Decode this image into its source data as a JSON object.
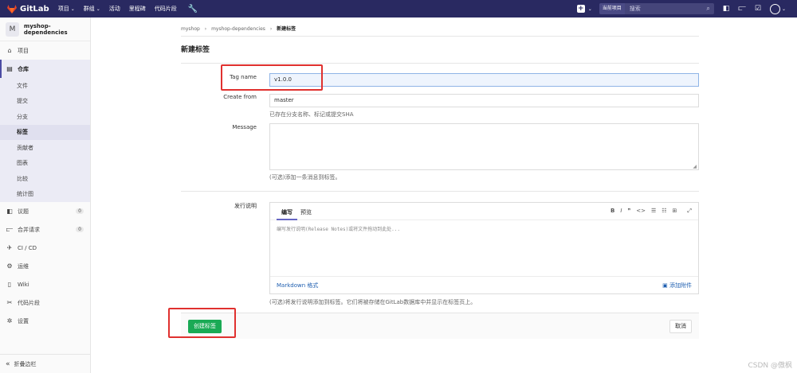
{
  "topbar": {
    "brand": "GitLab",
    "nav": [
      {
        "label": "项目",
        "caret": "⌄"
      },
      {
        "label": "群组",
        "caret": "⌄"
      },
      {
        "label": "活动",
        "caret": ""
      },
      {
        "label": "里程碑",
        "caret": ""
      },
      {
        "label": "代码片段",
        "caret": ""
      }
    ],
    "scope_chip": "当前项目",
    "search_placeholder": "搜索"
  },
  "sidebar": {
    "project_initial": "M",
    "project_name": "myshop-dependencies",
    "items": [
      {
        "label": "项目",
        "icon": "home-icon"
      },
      {
        "label": "仓库",
        "icon": "repo-icon"
      }
    ],
    "repo_sub": [
      "文件",
      "提交",
      "分支",
      "标签",
      "贡献者",
      "图表",
      "比较",
      "统计图"
    ],
    "current_sub": "标签",
    "items2": [
      {
        "label": "议题",
        "icon": "issues-icon",
        "badge": "0"
      },
      {
        "label": "合并请求",
        "icon": "merge-request-icon",
        "badge": "0"
      },
      {
        "label": "CI / CD",
        "icon": "rocket-icon",
        "badge": ""
      },
      {
        "label": "运维",
        "icon": "ops-icon",
        "badge": ""
      },
      {
        "label": "Wiki",
        "icon": "book-icon",
        "badge": ""
      },
      {
        "label": "代码片段",
        "icon": "snippet-icon",
        "badge": ""
      },
      {
        "label": "设置",
        "icon": "gear-icon",
        "badge": ""
      }
    ],
    "collapse_label": "折叠边栏"
  },
  "breadcrumb": {
    "group": "myshop",
    "project": "myshop-dependencies",
    "current": "新建标签",
    "sep": "›"
  },
  "page_title": "新建标签",
  "form": {
    "tag_label": "Tag name",
    "tag_value": "v1.0.0",
    "create_from_label": "Create from",
    "create_from_value": "master",
    "create_from_help": "已存在分支名称、标记或提交SHA",
    "message_label": "Message",
    "message_help": "(可选)添加一条消息到标签。",
    "release_label": "发行说明",
    "tab_write": "编写",
    "tab_preview": "预览",
    "toolbar": [
      "B",
      "I",
      "❞",
      "<>",
      "☰",
      "☷",
      "⊞",
      "⤢"
    ],
    "editor_placeholder": "编写发行说明(Release Notes)或将文件拖动到此处...",
    "markdown_link": "Markdown 格式",
    "attach_label": "添加附件",
    "release_help": "(可选)将发行说明添加到标签。它们将被存储在GitLab数据库中并显示在标签页上。"
  },
  "actions": {
    "create": "创建标签",
    "cancel": "取消"
  },
  "watermark": "CSDN @傲枫",
  "colors": {
    "topbar": "#292961",
    "create_button": "#1aaa55",
    "highlight": "#e0312f"
  }
}
